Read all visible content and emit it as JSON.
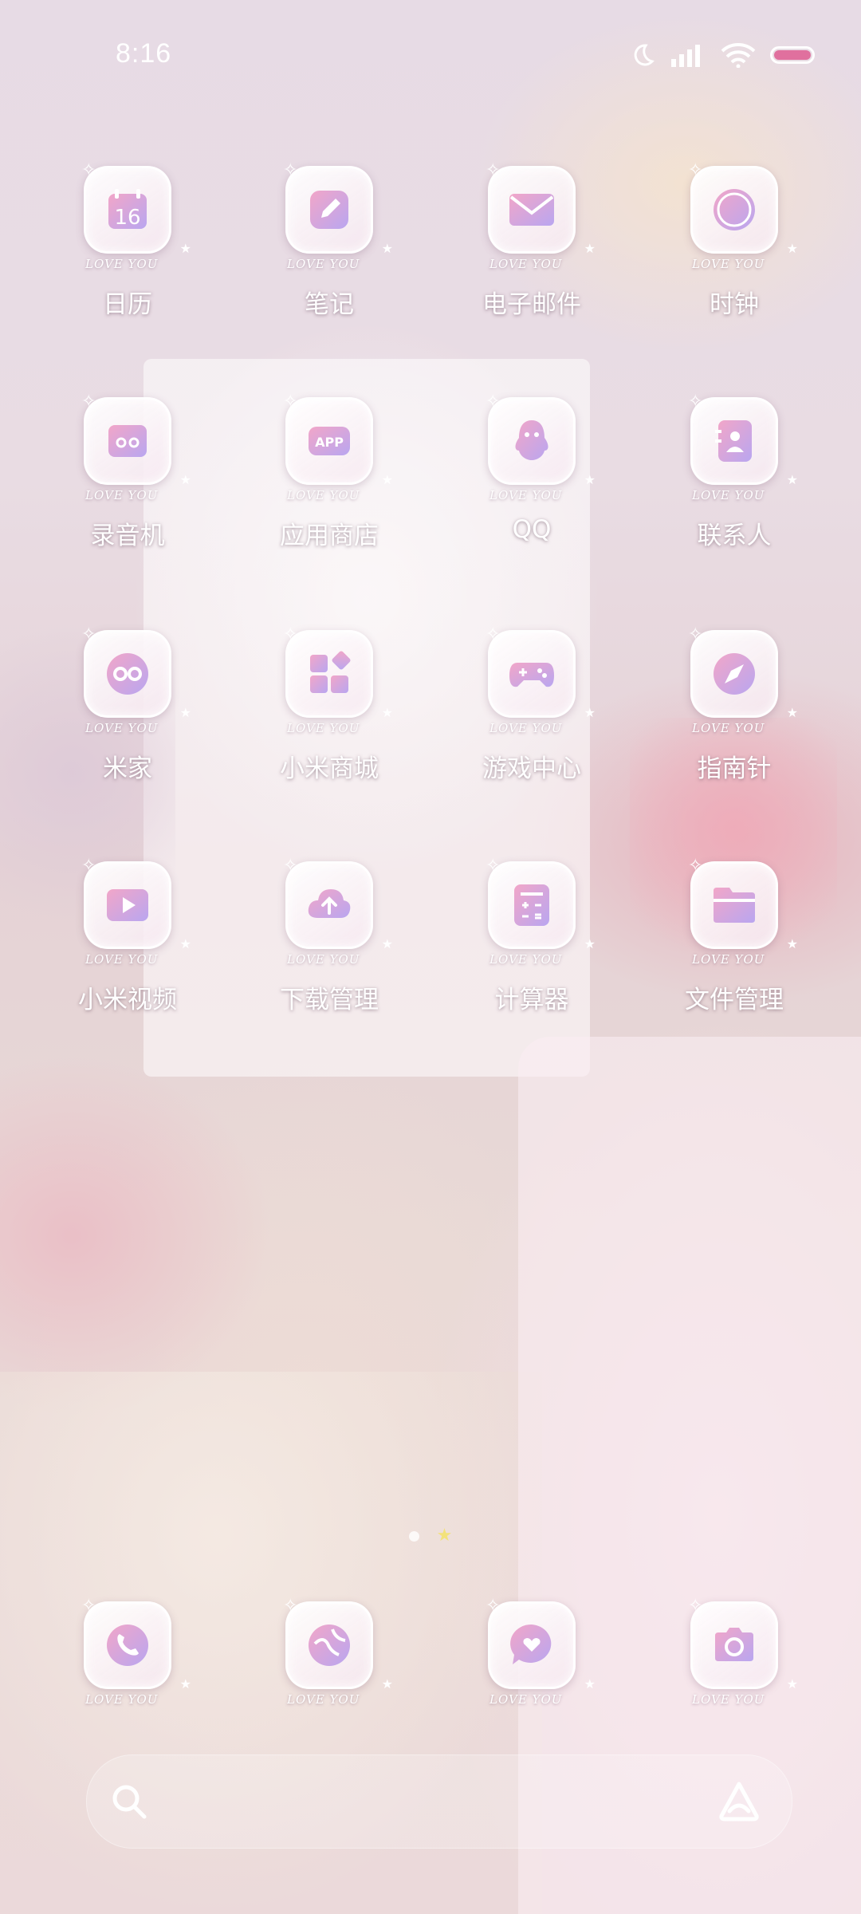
{
  "status_bar": {
    "time": "8:16",
    "icons": [
      "moon-icon",
      "signal-icon",
      "wifi-icon",
      "battery-icon"
    ],
    "battery_color": "#e0709e"
  },
  "icon_caption": "LOVE YOU",
  "apps": [
    {
      "label": "日历",
      "icon": "calendar-icon",
      "number": "16"
    },
    {
      "label": "笔记",
      "icon": "notes-icon"
    },
    {
      "label": "电子邮件",
      "icon": "mail-icon"
    },
    {
      "label": "时钟",
      "icon": "clock-icon"
    },
    {
      "label": "录音机",
      "icon": "recorder-icon"
    },
    {
      "label": "应用商店",
      "icon": "app-store-icon",
      "badge": "APP"
    },
    {
      "label": "QQ",
      "icon": "qq-icon"
    },
    {
      "label": "联系人",
      "icon": "contacts-icon"
    },
    {
      "label": "米家",
      "icon": "mijia-icon"
    },
    {
      "label": "小米商城",
      "icon": "mi-store-icon"
    },
    {
      "label": "游戏中心",
      "icon": "gamepad-icon"
    },
    {
      "label": "指南针",
      "icon": "compass-icon"
    },
    {
      "label": "小米视频",
      "icon": "video-icon"
    },
    {
      "label": "下载管理",
      "icon": "download-cloud-icon"
    },
    {
      "label": "计算器",
      "icon": "calculator-icon"
    },
    {
      "label": "文件管理",
      "icon": "folder-icon"
    }
  ],
  "dock": [
    {
      "icon": "phone-icon"
    },
    {
      "icon": "browser-icon"
    },
    {
      "icon": "messages-icon"
    },
    {
      "icon": "camera-icon"
    }
  ],
  "page_indicator": {
    "pages": 2,
    "current": 2
  },
  "bottom_bar": {
    "left_icon": "search-icon",
    "right_icon": "assistant-icon"
  },
  "colors": {
    "accent_gradient_start": "#f2a6c8",
    "accent_gradient_end": "#b9a6f0",
    "label_text": "#ffffff"
  }
}
